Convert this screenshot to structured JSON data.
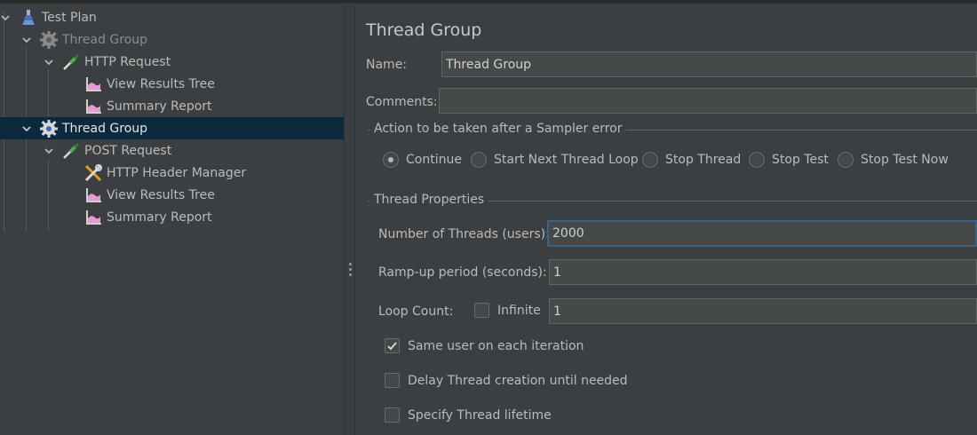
{
  "tree": {
    "nodes": [
      {
        "label": "Test Plan",
        "icon": "test-plan-icon",
        "expanded": true
      },
      {
        "label": "Thread Group",
        "icon": "gear-icon",
        "expanded": true,
        "disabled": true
      },
      {
        "label": "HTTP Request",
        "icon": "pipette-icon",
        "expanded": true
      },
      {
        "label": "View Results Tree",
        "icon": "listener-icon"
      },
      {
        "label": "Summary Report",
        "icon": "listener-icon"
      },
      {
        "label": "Thread Group",
        "icon": "gear-icon",
        "expanded": true,
        "selected": true
      },
      {
        "label": "POST Request",
        "icon": "pipette-icon",
        "expanded": true
      },
      {
        "label": "HTTP Header Manager",
        "icon": "wrench-icon"
      },
      {
        "label": "View Results Tree",
        "icon": "listener-icon"
      },
      {
        "label": "Summary Report",
        "icon": "listener-icon"
      }
    ]
  },
  "panel": {
    "title": "Thread Group",
    "name_label": "Name:",
    "name_value": "Thread Group",
    "comments_label": "Comments:",
    "comments_value": "",
    "sampler_error": {
      "title": "Action to be taken after a Sampler error",
      "options": [
        "Continue",
        "Start Next Thread Loop",
        "Stop Thread",
        "Stop Test",
        "Stop Test Now"
      ],
      "selected": "Continue"
    },
    "thread_props": {
      "title": "Thread Properties",
      "threads_label": "Number of Threads (users):",
      "threads_value": "2000",
      "rampup_label": "Ramp-up period (seconds):",
      "rampup_value": "1",
      "loop_label": "Loop Count:",
      "infinite_label": "Infinite",
      "infinite_checked": false,
      "loop_value": "1",
      "same_user_label": "Same user on each iteration",
      "same_user_checked": true,
      "delay_label": "Delay Thread creation until needed",
      "delay_checked": false,
      "lifetime_label": "Specify Thread lifetime",
      "lifetime_checked": false
    }
  },
  "colors": {
    "background": "#3c3f41",
    "selection": "#0d293e",
    "field_background": "#45494a",
    "focus_border": "#3d6185",
    "text": "#bbbbbb"
  }
}
